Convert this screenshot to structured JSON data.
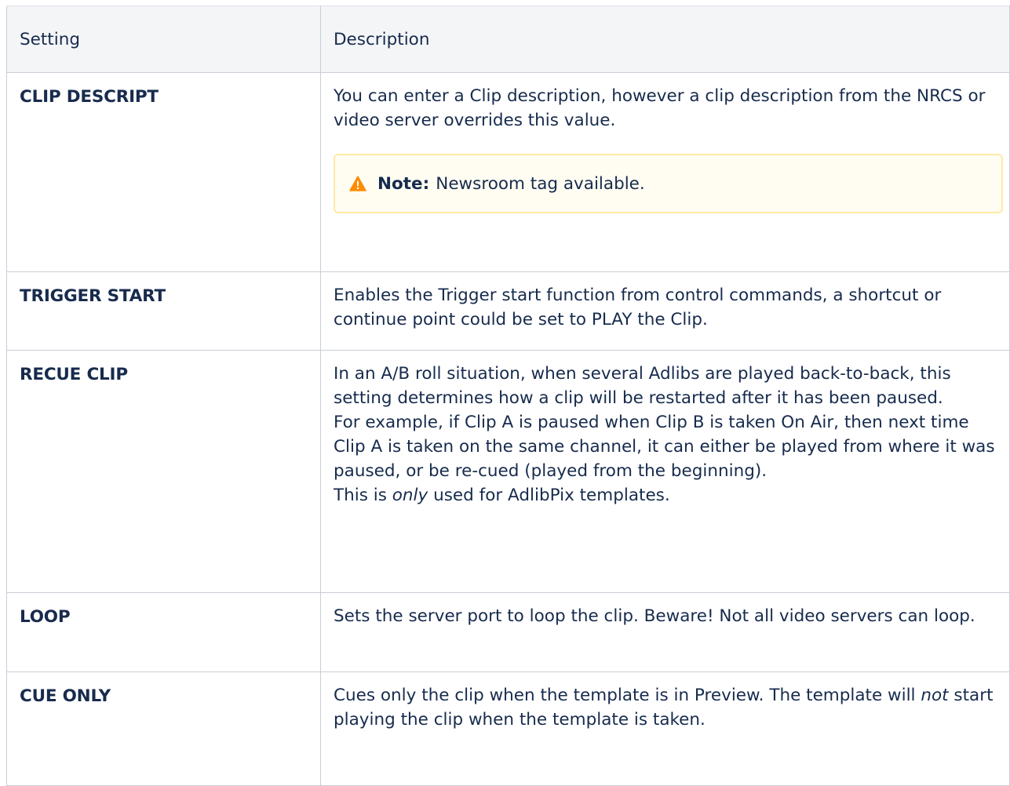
{
  "table": {
    "headers": {
      "setting": "Setting",
      "description": "Description"
    },
    "rows": [
      {
        "name": "CLIP DESCRIPT",
        "description": "You can enter a Clip description, however a clip description from the NRCS or video server overrides this value.",
        "note": {
          "label": "Note:",
          "text": "Newsroom tag available.",
          "icon": "warning-triangle-icon",
          "color": "#ff8b00"
        }
      },
      {
        "name": "TRIGGER START",
        "description": "Enables the Trigger start function from control commands, a shortcut or continue point could be set to PLAY the Clip."
      },
      {
        "name": "RECUE CLIP",
        "description": "In an A/B roll situation, when several Adlibs are played back-to-back, this setting determines how a clip will be restarted after it has been paused.",
        "description_2": "For example, if Clip A is paused when Clip B is taken On Air, then next time Clip A is taken on the same channel, it can either be played from where it was paused, or be re-cued (played from the beginning).",
        "description_3_pre": "This is ",
        "description_3_em": "only",
        "description_3_post": " used for AdlibPix templates."
      },
      {
        "name": "LOOP",
        "description": "Sets the server port to loop the clip. Beware! Not all video servers can loop."
      },
      {
        "name": "CUE ONLY",
        "description_pre": "Cues only the clip when the template is in Preview. The template will ",
        "description_em": "not",
        "description_post": " start playing the clip when the template is taken."
      }
    ]
  },
  "colors": {
    "header_bg": "#f4f5f7",
    "border": "#c9ced6",
    "note_border": "#ffe9a6",
    "note_bg": "#fffdf2"
  }
}
